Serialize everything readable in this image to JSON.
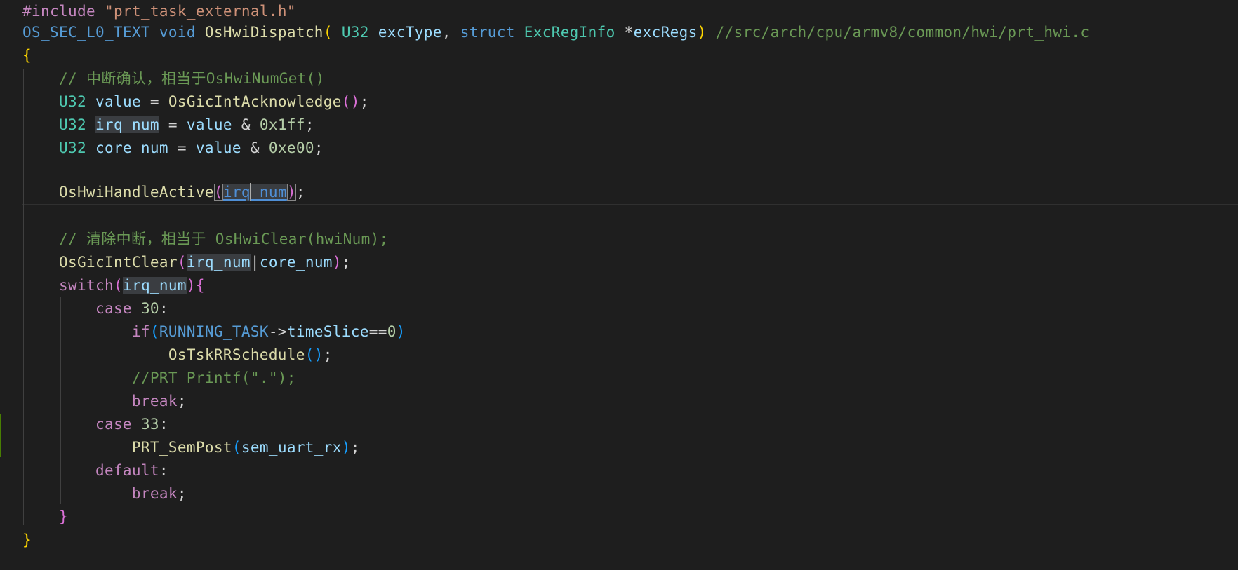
{
  "editor": {
    "theme_colors": {
      "background": "#1e1e1e",
      "keyword": "#569cd6",
      "control": "#c586c0",
      "type": "#4ec9b0",
      "function": "#dcdcaa",
      "variable": "#9cdcfe",
      "number": "#b5cea8",
      "comment": "#6a9955",
      "string": "#ce9178"
    },
    "code": {
      "l1": {
        "directive": "#include",
        "path": "\"prt_task_external.h\""
      },
      "l2": {
        "macro": "OS_SEC_L0_TEXT",
        "ret": "void",
        "fn": "OsHwiDispatch",
        "t1": "U32",
        "p1": "excType",
        "kw_struct": "struct",
        "t2": "ExcRegInfo",
        "p2": "excRegs",
        "comment": "//src/arch/cpu/armv8/common/hwi/prt_hwi.c"
      },
      "l3": {
        "brace": "{"
      },
      "l4": {
        "comment": "// 中断确认，相当于OsHwiNumGet()"
      },
      "l5": {
        "type": "U32",
        "var": "value",
        "fn": "OsGicIntAcknowledge"
      },
      "l6": {
        "type": "U32",
        "var": "irq_num",
        "src": "value",
        "num": "0x1ff"
      },
      "l7": {
        "type": "U32",
        "var": "core_num",
        "src": "value",
        "num": "0xe00"
      },
      "l9": {
        "fn": "OsHwiHandleActive",
        "arg_a": "irq",
        "arg_b": "_num"
      },
      "l11": {
        "comment": "// 清除中断，相当于 OsHwiClear(hwiNum);"
      },
      "l12": {
        "fn": "OsGicIntClear",
        "a1": "irq_num",
        "a2": "core_num"
      },
      "l13": {
        "kw": "switch",
        "var": "irq_num"
      },
      "l14": {
        "kw": "case",
        "num": "30"
      },
      "l15": {
        "kw": "if",
        "macro": "RUNNING_TASK",
        "field": "timeSlice",
        "num": "0"
      },
      "l16": {
        "fn": "OsTskRRSchedule"
      },
      "l17": {
        "comment": "//PRT_Printf(\".\");"
      },
      "l18": {
        "kw": "break"
      },
      "l19": {
        "kw": "case",
        "num": "33"
      },
      "l20": {
        "fn": "PRT_SemPost",
        "arg": "sem_uart_rx"
      },
      "l21": {
        "kw": "default"
      },
      "l22": {
        "kw": "break"
      },
      "l23": {
        "brace": "}"
      },
      "l24": {
        "brace": "}"
      }
    }
  }
}
